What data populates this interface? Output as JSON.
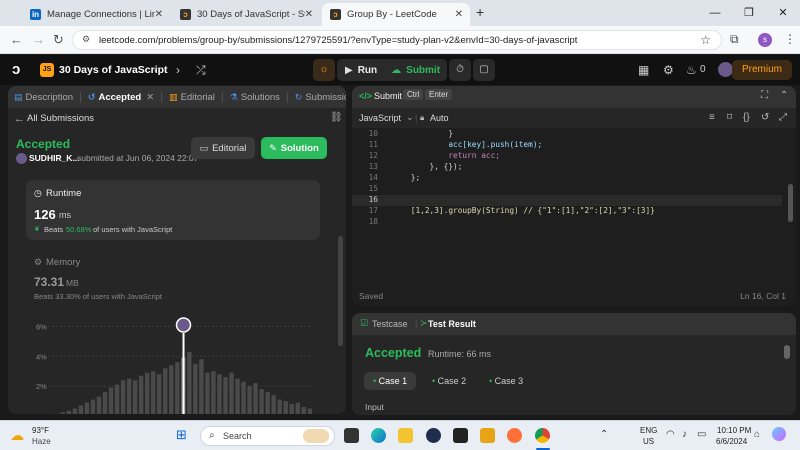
{
  "browser": {
    "tabs": [
      {
        "title": "Manage Connections | LinkedIn",
        "fav_color": "#0a66c2",
        "fav_text": "in",
        "active": false
      },
      {
        "title": "30 Days of JavaScript - Study Pl",
        "fav_color": "#ffa116",
        "fav_text": "",
        "active": false
      },
      {
        "title": "Group By - LeetCode",
        "fav_color": "#ffa116",
        "fav_text": "",
        "active": true
      }
    ],
    "new_tab": "+",
    "url": "leetcode.com/problems/group-by/submissions/1279725591/?envType=study-plan-v2&envId=30-days-of-javascript",
    "profile_initial": "s"
  },
  "lc_header": {
    "study_plan_badge": "JS",
    "study_plan_title": "30 Days of JavaScript",
    "run_label": "Run",
    "submit_label": "Submit",
    "streak_count": "0",
    "premium_label": "Premium"
  },
  "left_panel": {
    "tabs": [
      "Description",
      "Accepted",
      "Editorial",
      "Solutions",
      "Submissions"
    ],
    "all_submissions": "All Submissions",
    "status": "Accepted",
    "user": "SUDHIR_K...",
    "submitted_at": "submitted at Jun 06, 2024 22:07",
    "editorial_btn": "Editorial",
    "solution_btn": "Solution",
    "runtime_label": "Runtime",
    "runtime_value": "126",
    "runtime_unit": "ms",
    "runtime_beats_prefix": "Beats",
    "runtime_beats_pct": "50.68%",
    "runtime_beats_suffix": "of users with JavaScript",
    "memory_label": "Memory",
    "memory_value": "73.31",
    "memory_unit": "MB",
    "memory_beats": "Beats 33.30% of users with JavaScript",
    "chart_ticks": [
      "6%",
      "4%",
      "2%"
    ]
  },
  "chart_data": {
    "type": "bar",
    "ylim": [
      0,
      6.5
    ],
    "y_ticks": [
      6,
      4,
      2
    ],
    "values": [
      0.1,
      0.15,
      0.25,
      0.35,
      0.5,
      0.7,
      0.9,
      1.1,
      1.3,
      1.6,
      1.9,
      2.1,
      2.4,
      2.5,
      2.4,
      2.7,
      2.9,
      3.0,
      2.8,
      3.2,
      3.4,
      3.6,
      3.9,
      4.3,
      3.5,
      3.8,
      2.9,
      3.0,
      2.8,
      2.6,
      2.9,
      2.5,
      2.3,
      2.0,
      2.2,
      1.8,
      1.6,
      1.4,
      1.1,
      1.0,
      0.8,
      0.9,
      0.6,
      0.5
    ],
    "highlight_index": 22
  },
  "editor": {
    "submit_label": "Submit",
    "kbd_1": "Ctrl",
    "kbd_2": "Enter",
    "language": "JavaScript",
    "auto_label": "Auto",
    "saved_label": "Saved",
    "cursor_pos": "Ln 16, Col 1",
    "lines": [
      {
        "n": "10",
        "code": "            }"
      },
      {
        "n": "11",
        "code": "            acc[key].push(item);"
      },
      {
        "n": "12",
        "code": "            return acc;"
      },
      {
        "n": "13",
        "code": "        }, {});"
      },
      {
        "n": "14",
        "code": "    };"
      },
      {
        "n": "15",
        "code": ""
      },
      {
        "n": "16",
        "code": ""
      },
      {
        "n": "17",
        "code": "    [1,2,3].groupBy(String) // {\"1\":[1],\"2\":[2],\"3\":[3]}"
      },
      {
        "n": "18",
        "code": ""
      }
    ]
  },
  "result": {
    "testcase_tab": "Testcase",
    "testresult_tab": "Test Result",
    "status": "Accepted",
    "runtime": "Runtime: 66 ms",
    "cases": [
      "Case 1",
      "Case 2",
      "Case 3"
    ],
    "input_label": "Input"
  },
  "taskbar": {
    "weather_temp": "93°F",
    "weather_desc": "Haze",
    "search_placeholder": "Search",
    "lang_1": "ENG",
    "lang_2": "US",
    "time": "10:10 PM",
    "date": "6/6/2024"
  }
}
